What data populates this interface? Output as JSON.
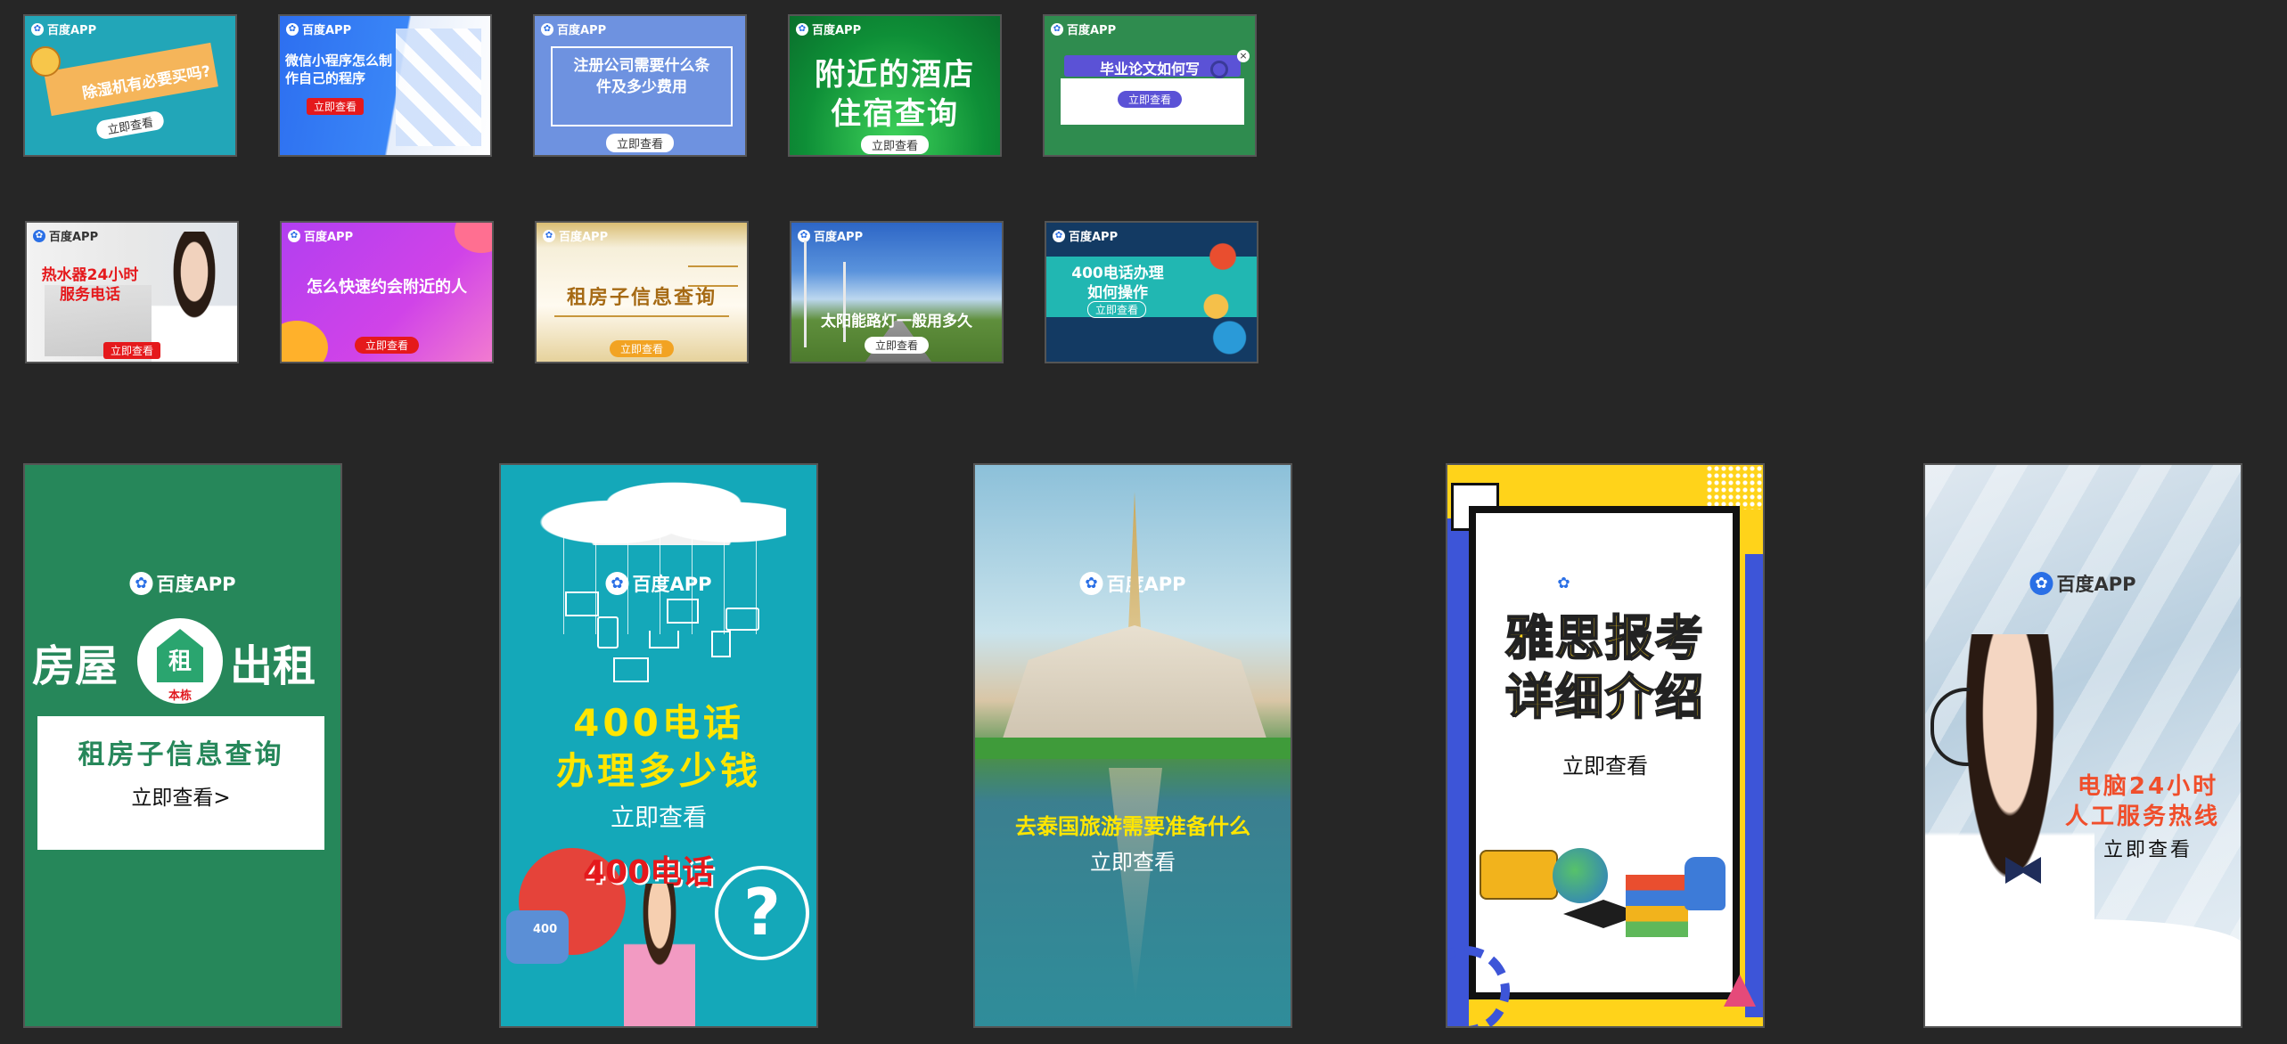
{
  "brand": "百度APP",
  "cta": "立即查看",
  "row1": [
    {
      "headline": "除湿机有必要买吗?",
      "cta": "立即查看"
    },
    {
      "headline": "微信小程序怎么制作自己的程序",
      "cta": "立即查看"
    },
    {
      "headline": "注册公司需要什么条件及多少费用",
      "cta": "立即查看"
    },
    {
      "headline_line1": "附近的酒店",
      "headline_line2": "住宿查询",
      "cta": "立即查看"
    },
    {
      "headline": "毕业论文如何写",
      "cta": "立即查看"
    }
  ],
  "row2": [
    {
      "headline_line1": "热水器24小时",
      "headline_line2": "服务电话",
      "cta": "立即查看"
    },
    {
      "headline": "怎么快速约会附近的人",
      "cta": "立即查看"
    },
    {
      "headline": "租房子信息查询",
      "cta": "立即查看"
    },
    {
      "headline": "太阳能路灯一般用多久",
      "cta": "立即查看"
    },
    {
      "headline_line1": "400电话办理",
      "headline_line2": "如何操作",
      "cta": "立即查看"
    }
  ],
  "tall": [
    {
      "left_word": "房屋",
      "icon_word": "租",
      "icon_sub": "本栋",
      "right_word": "出租",
      "box_title": "租房子信息查询",
      "box_cta": "立即查看>"
    },
    {
      "headline_line1": "400电话",
      "headline_line2": "办理多少钱",
      "cta": "立即查看",
      "badge": "400电话",
      "mini_label": "400"
    },
    {
      "headline": "去泰国旅游需要准备什么",
      "cta": "立即查看"
    },
    {
      "headline_line1": "雅思报考",
      "headline_line2": "详细介绍",
      "cta": "立即查看"
    },
    {
      "headline_line1": "电脑24小时",
      "headline_line2": "人工服务热线",
      "cta": "立即查看"
    }
  ],
  "colors": {
    "background": "#262626",
    "accent_red": "#e0191f",
    "accent_yellow": "#ffe600"
  }
}
